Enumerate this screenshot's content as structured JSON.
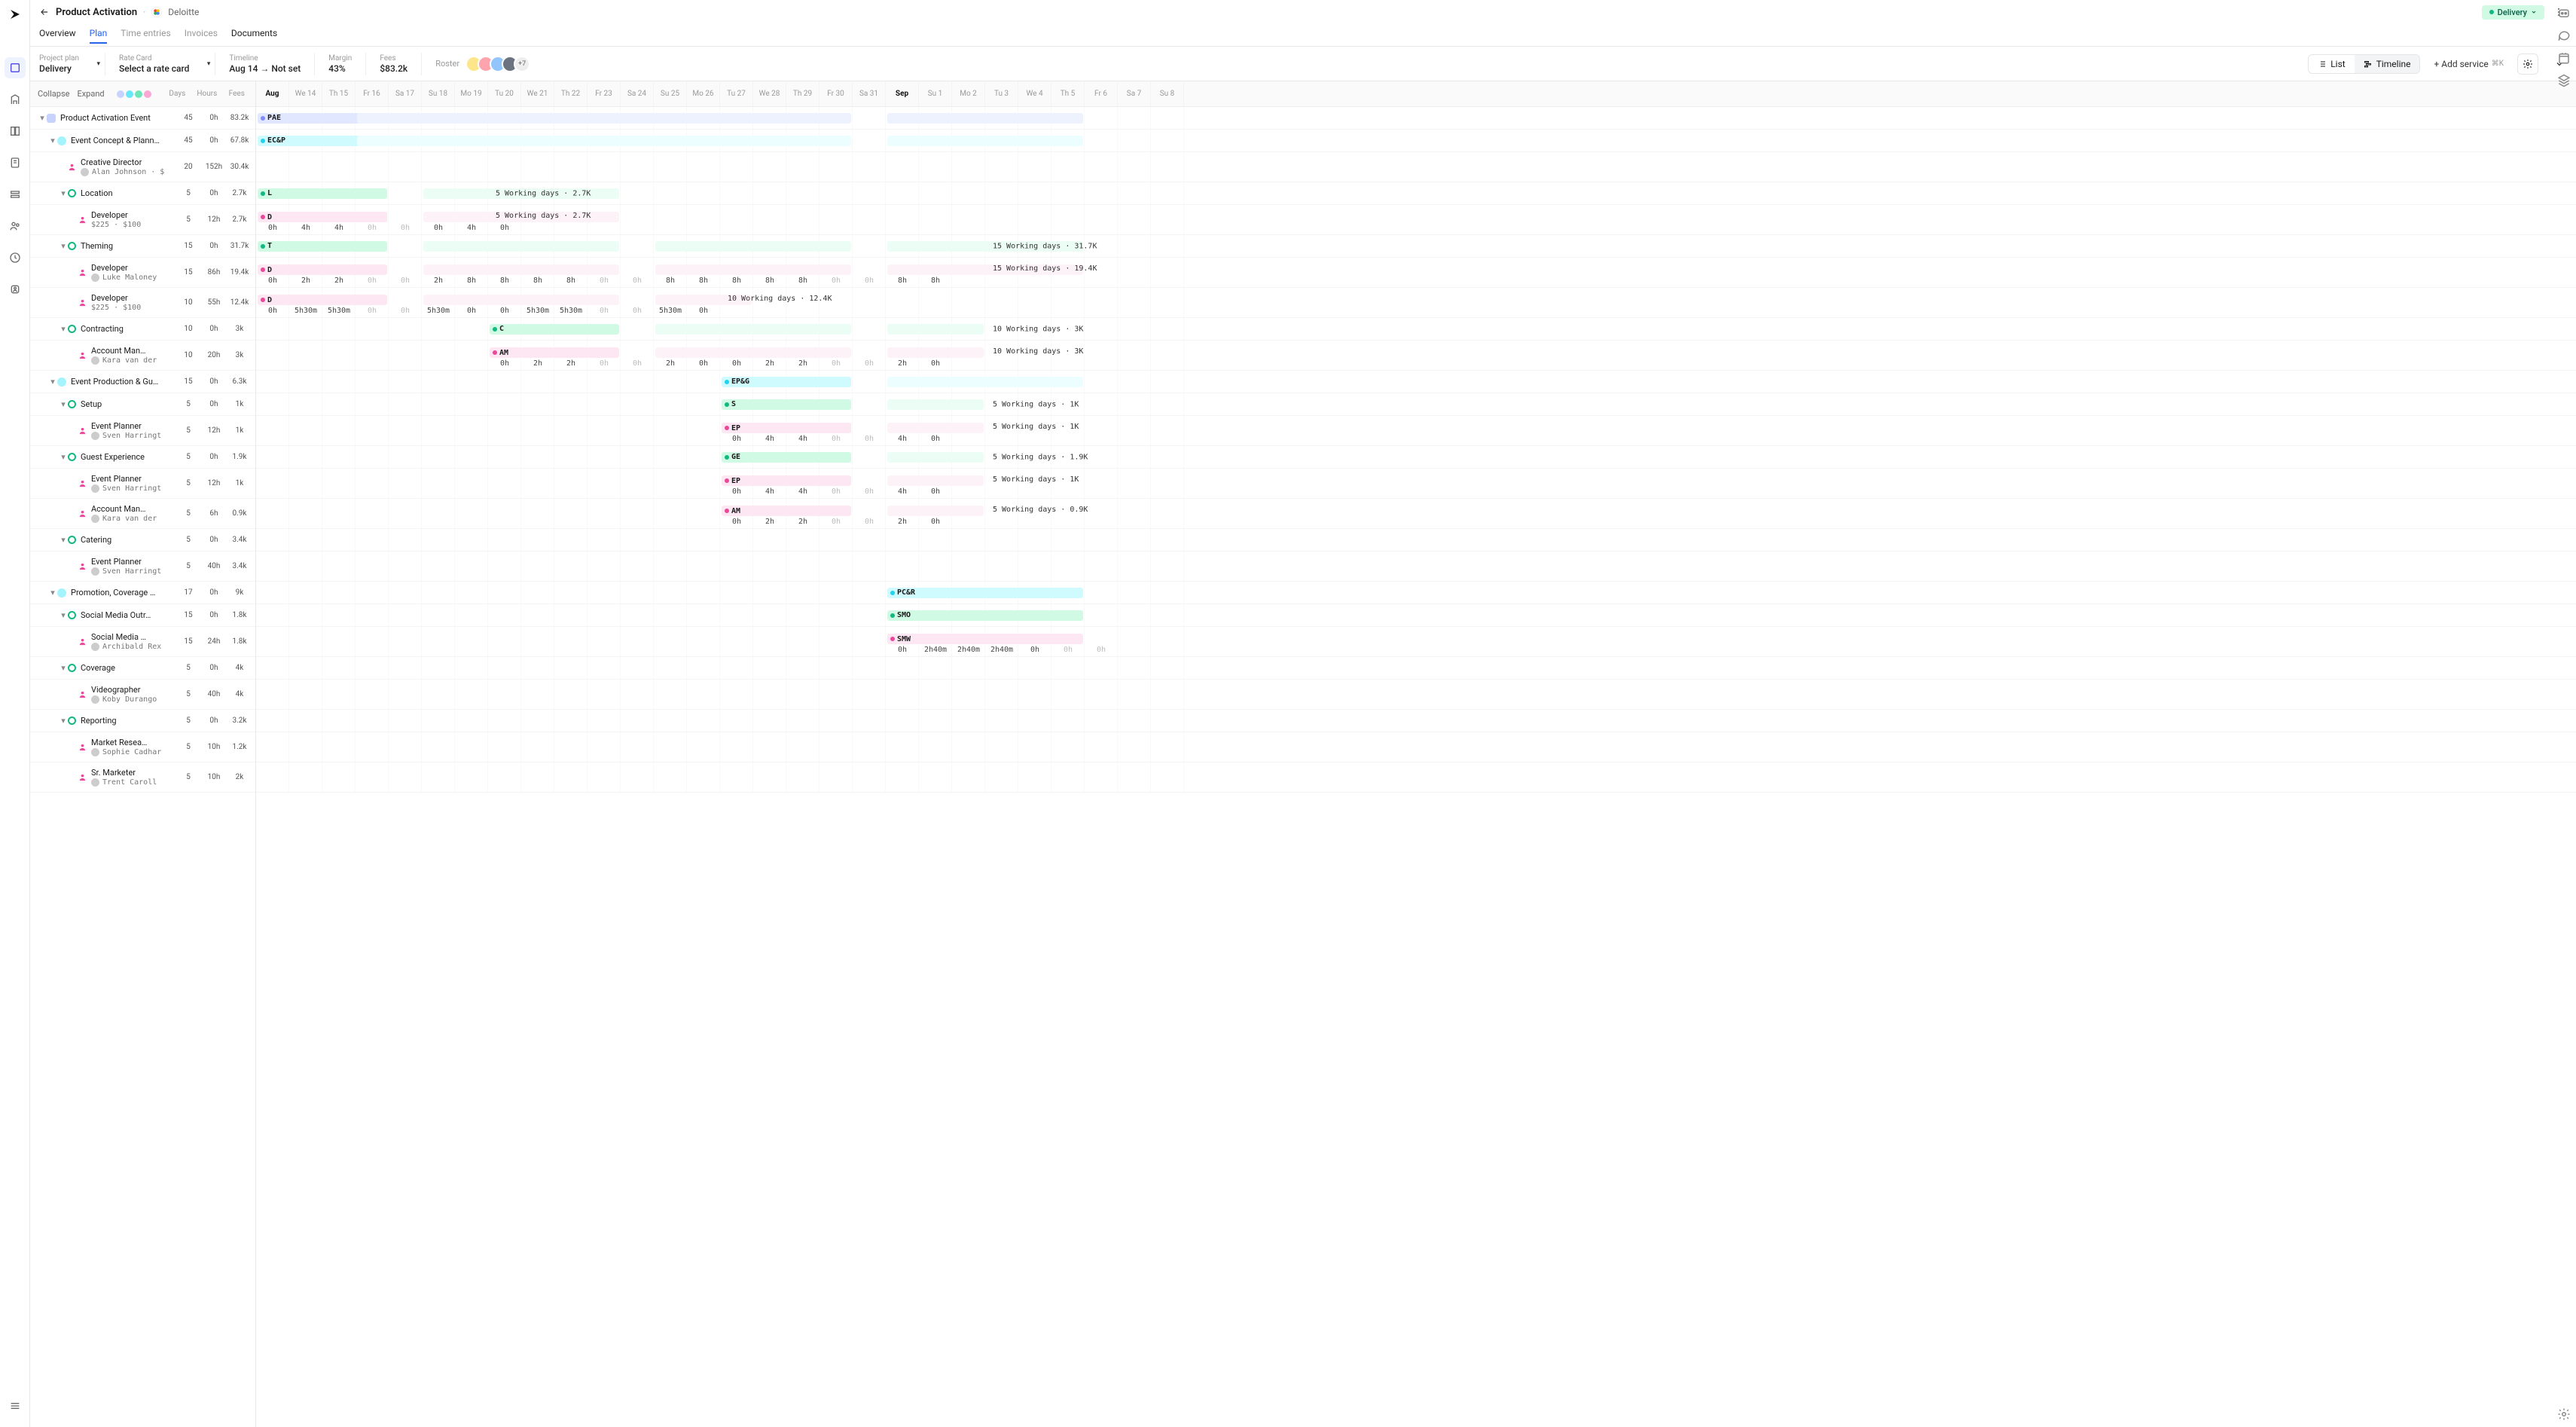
{
  "header": {
    "title": "Product Activation",
    "client": "Deloitte",
    "status": "Delivery"
  },
  "tabs": [
    "Overview",
    "Plan",
    "Time entries",
    "Invoices",
    "Documents"
  ],
  "toolbar": {
    "project_plan_label": "Project plan",
    "project_plan_value": "Delivery",
    "rate_card_label": "Rate Card",
    "rate_card_value": "Select a rate card",
    "timeline_label": "Timeline",
    "timeline_value": "Aug 14 → Not set",
    "margin_label": "Margin",
    "margin_value": "43%",
    "fees_label": "Fees",
    "fees_value": "$83.2k",
    "roster_label": "Roster",
    "roster_more": "+7",
    "list_label": "List",
    "timeline_btn": "Timeline",
    "add_service": "+ Add service",
    "add_service_kbd": "⌘K"
  },
  "tree_header": {
    "collapse": "Collapse",
    "expand": "Expand",
    "days": "Days",
    "hours": "Hours",
    "fees": "Fees"
  },
  "dates": [
    {
      "l": "Aug",
      "b": true
    },
    {
      "l": "We 14"
    },
    {
      "l": "Th 15"
    },
    {
      "l": "Fr 16"
    },
    {
      "l": "Sa 17"
    },
    {
      "l": "Su 18"
    },
    {
      "l": "Mo 19"
    },
    {
      "l": "Tu 20"
    },
    {
      "l": "We 21"
    },
    {
      "l": "Th 22"
    },
    {
      "l": "Fr 23"
    },
    {
      "l": "Sa 24"
    },
    {
      "l": "Su 25"
    },
    {
      "l": "Mo 26"
    },
    {
      "l": "Tu 27"
    },
    {
      "l": "We 28"
    },
    {
      "l": "Th 29"
    },
    {
      "l": "Fr 30"
    },
    {
      "l": "Sa 31"
    },
    {
      "l": "Sep",
      "b": true
    },
    {
      "l": "Su 1"
    },
    {
      "l": "Mo 2"
    },
    {
      "l": "Tu 3"
    },
    {
      "l": "We 4"
    },
    {
      "l": "Th 5"
    },
    {
      "l": "Fr 6"
    },
    {
      "l": "Sa 7"
    },
    {
      "l": "Su 8"
    }
  ],
  "rows": [
    {
      "type": "proj",
      "indent": 0,
      "title": "Product Activation Event",
      "days": "45",
      "hours": "0h",
      "fees": "83.2k",
      "color": "#c7d2fe",
      "bars": [
        {
          "s": 0,
          "e": 3,
          "c": "#e0e7ff",
          "t": "PAE",
          "d": "#818cf8"
        },
        {
          "s": 3,
          "e": 17,
          "c": "#eef2ff"
        },
        {
          "s": 19,
          "e": 24,
          "c": "#eef2ff"
        }
      ]
    },
    {
      "type": "phase",
      "indent": 1,
      "title": "Event Concept & Plann…",
      "days": "45",
      "hours": "0h",
      "fees": "67.8k",
      "color": "#a5f3fc",
      "bars": [
        {
          "s": 0,
          "e": 3,
          "c": "#cffafe",
          "t": "EC&P",
          "d": "#22d3ee"
        },
        {
          "s": 3,
          "e": 17,
          "c": "#ecfeff"
        },
        {
          "s": 19,
          "e": 24,
          "c": "#ecfeff"
        }
      ]
    },
    {
      "type": "role",
      "indent": 2,
      "title": "Creative Director",
      "sub": "Alan Johnson · $",
      "days": "20",
      "hours": "152h",
      "fees": "30.4k",
      "tall": true,
      "bars": []
    },
    {
      "type": "task",
      "indent": 2,
      "title": "Location",
      "days": "5",
      "hours": "0h",
      "fees": "2.7k",
      "ring": "#10b981",
      "bars": [
        {
          "s": 0,
          "e": 3,
          "c": "#d1fae5",
          "t": "L",
          "d": "#10b981"
        },
        {
          "s": 5,
          "e": 10,
          "c": "#ecfdf5"
        }
      ],
      "after": {
        "col": 7,
        "text": "5 Working days · 2.7K"
      }
    },
    {
      "type": "role",
      "indent": 3,
      "title": "Developer",
      "sub": "$225 · $100",
      "days": "5",
      "hours": "12h",
      "fees": "2.7k",
      "tall": true,
      "bars": [
        {
          "s": 0,
          "e": 3,
          "c": "#fce7f3",
          "t": "D",
          "d": "#ec4899"
        },
        {
          "s": 5,
          "e": 10,
          "c": "#fdf2f8"
        }
      ],
      "after": {
        "col": 7,
        "text": "5 Working days · 2.7K"
      },
      "cells": [
        {
          "c": 0,
          "v": "0h"
        },
        {
          "c": 1,
          "v": "4h"
        },
        {
          "c": 2,
          "v": "4h"
        },
        {
          "c": 3,
          "v": "0h",
          "g": 1
        },
        {
          "c": 4,
          "v": "0h",
          "g": 1
        },
        {
          "c": 5,
          "v": "0h"
        },
        {
          "c": 6,
          "v": "4h"
        },
        {
          "c": 7,
          "v": "0h"
        }
      ],
      "cellsTop": true
    },
    {
      "type": "task",
      "indent": 2,
      "title": "Theming",
      "days": "15",
      "hours": "0h",
      "fees": "31.7k",
      "ring": "#10b981",
      "bars": [
        {
          "s": 0,
          "e": 3,
          "c": "#d1fae5",
          "t": "T",
          "d": "#10b981"
        },
        {
          "s": 5,
          "e": 10,
          "c": "#ecfdf5"
        },
        {
          "s": 12,
          "e": 17,
          "c": "#ecfdf5"
        },
        {
          "s": 19,
          "e": 24,
          "c": "#ecfdf5"
        }
      ],
      "after": {
        "col": 22,
        "text": "15 Working days · 31.7K"
      }
    },
    {
      "type": "role",
      "indent": 3,
      "title": "Developer",
      "sub": "Luke Maloney",
      "days": "15",
      "hours": "86h",
      "fees": "19.4k",
      "tall": true,
      "bars": [
        {
          "s": 0,
          "e": 3,
          "c": "#fce7f3",
          "t": "D",
          "d": "#ec4899"
        },
        {
          "s": 5,
          "e": 10,
          "c": "#fdf2f8"
        },
        {
          "s": 12,
          "e": 17,
          "c": "#fdf2f8"
        },
        {
          "s": 19,
          "e": 24,
          "c": "#fdf2f8"
        }
      ],
      "after": {
        "col": 22,
        "text": "15 Working days · 19.4K"
      },
      "cells": [
        {
          "c": 0,
          "v": "0h"
        },
        {
          "c": 1,
          "v": "2h"
        },
        {
          "c": 2,
          "v": "2h"
        },
        {
          "c": 3,
          "v": "0h",
          "g": 1
        },
        {
          "c": 4,
          "v": "0h",
          "g": 1
        },
        {
          "c": 5,
          "v": "2h"
        },
        {
          "c": 6,
          "v": "8h"
        },
        {
          "c": 7,
          "v": "8h"
        },
        {
          "c": 8,
          "v": "8h"
        },
        {
          "c": 9,
          "v": "8h"
        },
        {
          "c": 10,
          "v": "0h",
          "g": 1
        },
        {
          "c": 11,
          "v": "0h",
          "g": 1
        },
        {
          "c": 12,
          "v": "8h"
        },
        {
          "c": 13,
          "v": "8h"
        },
        {
          "c": 14,
          "v": "8h"
        },
        {
          "c": 15,
          "v": "8h"
        },
        {
          "c": 16,
          "v": "8h"
        },
        {
          "c": 17,
          "v": "0h",
          "g": 1
        },
        {
          "c": 18,
          "v": "0h",
          "g": 1
        },
        {
          "c": 19,
          "v": "8h"
        },
        {
          "c": 20,
          "v": "8h"
        }
      ],
      "cellsTop": true
    },
    {
      "type": "role",
      "indent": 3,
      "title": "Developer",
      "sub": "$225 · $100",
      "days": "10",
      "hours": "55h",
      "fees": "12.4k",
      "tall": true,
      "bars": [
        {
          "s": 0,
          "e": 3,
          "c": "#fce7f3",
          "t": "D",
          "d": "#ec4899"
        },
        {
          "s": 5,
          "e": 10,
          "c": "#fdf2f8"
        },
        {
          "s": 12,
          "e": 14,
          "c": "#fdf2f8"
        }
      ],
      "after": {
        "col": 14,
        "text": "10 Working days · 12.4K"
      },
      "cells": [
        {
          "c": 0,
          "v": "0h"
        },
        {
          "c": 1,
          "v": "5h30m"
        },
        {
          "c": 2,
          "v": "5h30m"
        },
        {
          "c": 3,
          "v": "0h",
          "g": 1
        },
        {
          "c": 4,
          "v": "0h",
          "g": 1
        },
        {
          "c": 5,
          "v": "5h30m"
        },
        {
          "c": 6,
          "v": "0h"
        },
        {
          "c": 7,
          "v": "0h"
        },
        {
          "c": 8,
          "v": "5h30m"
        },
        {
          "c": 9,
          "v": "5h30m"
        },
        {
          "c": 10,
          "v": "0h",
          "g": 1
        },
        {
          "c": 11,
          "v": "0h",
          "g": 1
        },
        {
          "c": 12,
          "v": "5h30m"
        },
        {
          "c": 13,
          "v": "0h"
        }
      ],
      "cellsTop": true
    },
    {
      "type": "task",
      "indent": 2,
      "title": "Contracting",
      "days": "10",
      "hours": "0h",
      "fees": "3k",
      "ring": "#10b981",
      "bars": [
        {
          "s": 7,
          "e": 10,
          "c": "#d1fae5",
          "t": "C",
          "d": "#10b981"
        },
        {
          "s": 12,
          "e": 17,
          "c": "#ecfdf5"
        },
        {
          "s": 19,
          "e": 21,
          "c": "#ecfdf5"
        }
      ],
      "after": {
        "col": 22,
        "text": "10 Working days · 3K"
      }
    },
    {
      "type": "role",
      "indent": 3,
      "title": "Account Man…",
      "sub": "Kara van der",
      "days": "10",
      "hours": "20h",
      "fees": "3k",
      "tall": true,
      "bars": [
        {
          "s": 7,
          "e": 10,
          "c": "#fce7f3",
          "t": "AM",
          "d": "#ec4899"
        },
        {
          "s": 12,
          "e": 17,
          "c": "#fdf2f8"
        },
        {
          "s": 19,
          "e": 21,
          "c": "#fdf2f8"
        }
      ],
      "after": {
        "col": 22,
        "text": "10 Working days · 3K"
      },
      "cells": [
        {
          "c": 7,
          "v": "0h"
        },
        {
          "c": 8,
          "v": "2h"
        },
        {
          "c": 9,
          "v": "2h"
        },
        {
          "c": 10,
          "v": "0h",
          "g": 1
        },
        {
          "c": 11,
          "v": "0h",
          "g": 1
        },
        {
          "c": 12,
          "v": "2h"
        },
        {
          "c": 13,
          "v": "0h"
        },
        {
          "c": 14,
          "v": "0h"
        },
        {
          "c": 15,
          "v": "2h"
        },
        {
          "c": 16,
          "v": "2h"
        },
        {
          "c": 17,
          "v": "0h",
          "g": 1
        },
        {
          "c": 18,
          "v": "0h",
          "g": 1
        },
        {
          "c": 19,
          "v": "2h"
        },
        {
          "c": 20,
          "v": "0h"
        }
      ],
      "cellsTop": true
    },
    {
      "type": "phase",
      "indent": 1,
      "title": "Event Production & Gu…",
      "days": "15",
      "hours": "0h",
      "fees": "6.3k",
      "color": "#a5f3fc",
      "bars": [
        {
          "s": 14,
          "e": 17,
          "c": "#cffafe",
          "t": "EP&G",
          "d": "#22d3ee"
        },
        {
          "s": 19,
          "e": 24,
          "c": "#ecfeff"
        }
      ]
    },
    {
      "type": "task",
      "indent": 2,
      "title": "Setup",
      "days": "5",
      "hours": "0h",
      "fees": "1k",
      "ring": "#10b981",
      "bars": [
        {
          "s": 14,
          "e": 17,
          "c": "#d1fae5",
          "t": "S",
          "d": "#10b981"
        },
        {
          "s": 19,
          "e": 21,
          "c": "#ecfdf5"
        }
      ],
      "after": {
        "col": 22,
        "text": "5 Working days · 1K"
      }
    },
    {
      "type": "role",
      "indent": 3,
      "title": "Event Planner",
      "sub": "Sven Harringt",
      "days": "5",
      "hours": "12h",
      "fees": "1k",
      "tall": true,
      "bars": [
        {
          "s": 14,
          "e": 17,
          "c": "#fce7f3",
          "t": "EP",
          "d": "#ec4899"
        },
        {
          "s": 19,
          "e": 21,
          "c": "#fdf2f8"
        }
      ],
      "after": {
        "col": 22,
        "text": "5 Working days · 1K"
      },
      "cells": [
        {
          "c": 14,
          "v": "0h"
        },
        {
          "c": 15,
          "v": "4h"
        },
        {
          "c": 16,
          "v": "4h"
        },
        {
          "c": 17,
          "v": "0h",
          "g": 1
        },
        {
          "c": 18,
          "v": "0h",
          "g": 1
        },
        {
          "c": 19,
          "v": "4h"
        },
        {
          "c": 20,
          "v": "0h"
        }
      ],
      "cellsTop": true
    },
    {
      "type": "task",
      "indent": 2,
      "title": "Guest Experience",
      "days": "5",
      "hours": "0h",
      "fees": "1.9k",
      "ring": "#10b981",
      "bars": [
        {
          "s": 14,
          "e": 17,
          "c": "#d1fae5",
          "t": "GE",
          "d": "#10b981"
        },
        {
          "s": 19,
          "e": 21,
          "c": "#ecfdf5"
        }
      ],
      "after": {
        "col": 22,
        "text": "5 Working days · 1.9K"
      }
    },
    {
      "type": "role",
      "indent": 3,
      "title": "Event Planner",
      "sub": "Sven Harringt",
      "days": "5",
      "hours": "12h",
      "fees": "1k",
      "tall": true,
      "bars": [
        {
          "s": 14,
          "e": 17,
          "c": "#fce7f3",
          "t": "EP",
          "d": "#ec4899"
        },
        {
          "s": 19,
          "e": 21,
          "c": "#fdf2f8"
        }
      ],
      "after": {
        "col": 22,
        "text": "5 Working days · 1K"
      },
      "cells": [
        {
          "c": 14,
          "v": "0h"
        },
        {
          "c": 15,
          "v": "4h"
        },
        {
          "c": 16,
          "v": "4h"
        },
        {
          "c": 17,
          "v": "0h",
          "g": 1
        },
        {
          "c": 18,
          "v": "0h",
          "g": 1
        },
        {
          "c": 19,
          "v": "4h"
        },
        {
          "c": 20,
          "v": "0h"
        }
      ],
      "cellsTop": true
    },
    {
      "type": "role",
      "indent": 3,
      "title": "Account Man…",
      "sub": "Kara van der",
      "days": "5",
      "hours": "6h",
      "fees": "0.9k",
      "tall": true,
      "bars": [
        {
          "s": 14,
          "e": 17,
          "c": "#fce7f3",
          "t": "AM",
          "d": "#ec4899"
        },
        {
          "s": 19,
          "e": 21,
          "c": "#fdf2f8"
        }
      ],
      "after": {
        "col": 22,
        "text": "5 Working days · 0.9K"
      },
      "cells": [
        {
          "c": 14,
          "v": "0h"
        },
        {
          "c": 15,
          "v": "2h"
        },
        {
          "c": 16,
          "v": "2h"
        },
        {
          "c": 17,
          "v": "0h",
          "g": 1
        },
        {
          "c": 18,
          "v": "0h",
          "g": 1
        },
        {
          "c": 19,
          "v": "2h"
        },
        {
          "c": 20,
          "v": "0h"
        }
      ],
      "cellsTop": true
    },
    {
      "type": "task",
      "indent": 2,
      "title": "Catering",
      "days": "5",
      "hours": "0h",
      "fees": "3.4k",
      "ring": "#10b981",
      "bars": []
    },
    {
      "type": "role",
      "indent": 3,
      "title": "Event Planner",
      "sub": "Sven Harringt",
      "days": "5",
      "hours": "40h",
      "fees": "3.4k",
      "tall": true,
      "bars": []
    },
    {
      "type": "phase",
      "indent": 1,
      "title": "Promotion, Coverage …",
      "days": "17",
      "hours": "0h",
      "fees": "9k",
      "color": "#a5f3fc",
      "bars": [
        {
          "s": 19,
          "e": 24,
          "c": "#cffafe",
          "t": "PC&R",
          "d": "#22d3ee"
        }
      ]
    },
    {
      "type": "task",
      "indent": 2,
      "title": "Social Media Outr…",
      "days": "15",
      "hours": "0h",
      "fees": "1.8k",
      "ring": "#10b981",
      "bars": [
        {
          "s": 19,
          "e": 24,
          "c": "#d1fae5",
          "t": "SMO",
          "d": "#10b981"
        }
      ]
    },
    {
      "type": "role",
      "indent": 3,
      "title": "Social Media …",
      "sub": "Archibald Rex",
      "days": "15",
      "hours": "24h",
      "fees": "1.8k",
      "tall": true,
      "bars": [
        {
          "s": 19,
          "e": 24,
          "c": "#fce7f3",
          "t": "SMW",
          "d": "#ec4899"
        }
      ],
      "cells": [
        {
          "c": 19,
          "v": "0h"
        },
        {
          "c": 20,
          "v": "2h40m"
        },
        {
          "c": 21,
          "v": "2h40m"
        },
        {
          "c": 22,
          "v": "2h40m"
        },
        {
          "c": 23,
          "v": "0h"
        },
        {
          "c": 24,
          "v": "0h",
          "g": 1
        },
        {
          "c": 25,
          "v": "0h",
          "g": 1
        }
      ],
      "cellsTop": true
    },
    {
      "type": "task",
      "indent": 2,
      "title": "Coverage",
      "days": "5",
      "hours": "0h",
      "fees": "4k",
      "ring": "#10b981",
      "bars": []
    },
    {
      "type": "role",
      "indent": 3,
      "title": "Videographer",
      "sub": "Koby Durango",
      "days": "5",
      "hours": "40h",
      "fees": "4k",
      "tall": true,
      "bars": []
    },
    {
      "type": "task",
      "indent": 2,
      "title": "Reporting",
      "days": "5",
      "hours": "0h",
      "fees": "3.2k",
      "ring": "#10b981",
      "bars": []
    },
    {
      "type": "role",
      "indent": 3,
      "title": "Market Resea…",
      "sub": "Sophie Cadhar",
      "days": "5",
      "hours": "10h",
      "fees": "1.2k",
      "tall": true,
      "bars": []
    },
    {
      "type": "role",
      "indent": 3,
      "title": "Sr. Marketer",
      "sub": "Trent Caroll",
      "days": "5",
      "hours": "10h",
      "fees": "2k",
      "tall": true,
      "bars": []
    }
  ]
}
